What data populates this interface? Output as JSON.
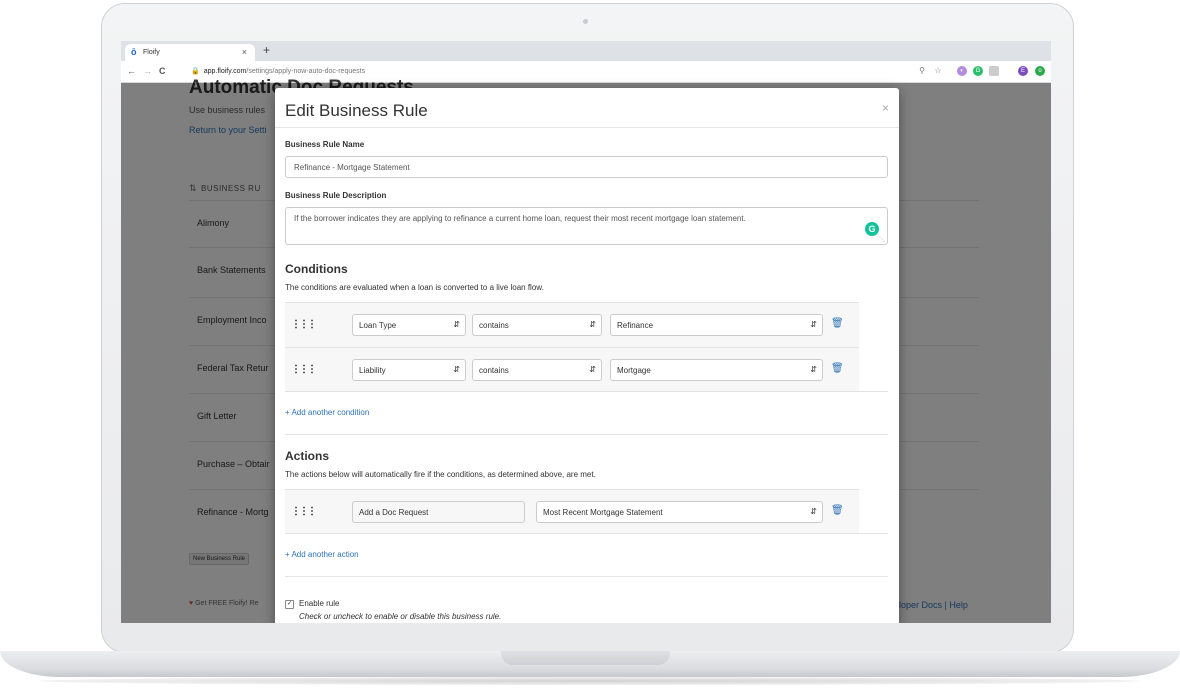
{
  "browser": {
    "tab_title": "Floify",
    "tab_favicon": "ō",
    "tab_close": "×",
    "new_tab": "+",
    "url_host": "app.floify.com",
    "url_path": "/settings/apply-now-auto-doc-requests",
    "nav_back": "←",
    "nav_forward": "→",
    "nav_reload": "C",
    "icons": [
      "zoom-icon",
      "star-icon",
      "extension-icon",
      "extension-icon",
      "extension-icon",
      "profile-icon",
      "extension-icon"
    ]
  },
  "page": {
    "title": "Automatic Doc Requests",
    "subtitle": "Use business rules",
    "return_link": "Return to your Setti",
    "section_label": "BUSINESS RU",
    "rules": [
      "Alimony",
      "Bank Statements",
      "Employment Inco",
      "Federal Tax Retur",
      "Gift Letter",
      "Purchase – Obtair",
      "Refinance - Mortg"
    ],
    "new_rule_button": "New Business Rule",
    "footer_left": "Get FREE Floify! Re",
    "footer_right": "loper Docs | Help"
  },
  "modal": {
    "title": "Edit Business Rule",
    "close": "×",
    "name_label": "Business Rule Name",
    "name_value": "Refinance - Mortgage Statement",
    "desc_label": "Business Rule Description",
    "desc_value": "If the borrower indicates they are applying to refinance a current home loan, request their most recent mortgage loan statement.",
    "conditions_heading": "Conditions",
    "conditions_desc": "The conditions are evaluated when a loan is converted to a live loan flow.",
    "conditions": [
      {
        "field": "Loan Type",
        "operator": "contains",
        "value": "Refinance"
      },
      {
        "field": "Liability",
        "operator": "contains",
        "value": "Mortgage"
      }
    ],
    "add_condition": "+ Add another condition",
    "actions_heading": "Actions",
    "actions_desc": "The actions below will automatically fire if the conditions, as determined above, are met.",
    "action": {
      "type": "Add a Doc Request",
      "value": "Most Recent Mortgage Statement"
    },
    "add_action": "+ Add another action",
    "enable_label": "Enable rule",
    "enable_help": "Check or uncheck to enable or disable this business rule.",
    "enable_checked": true
  },
  "colors": {
    "link": "#2e73b8",
    "overlay": "rgba(0,0,0,0.5)",
    "grammarly": "#15c39a"
  }
}
